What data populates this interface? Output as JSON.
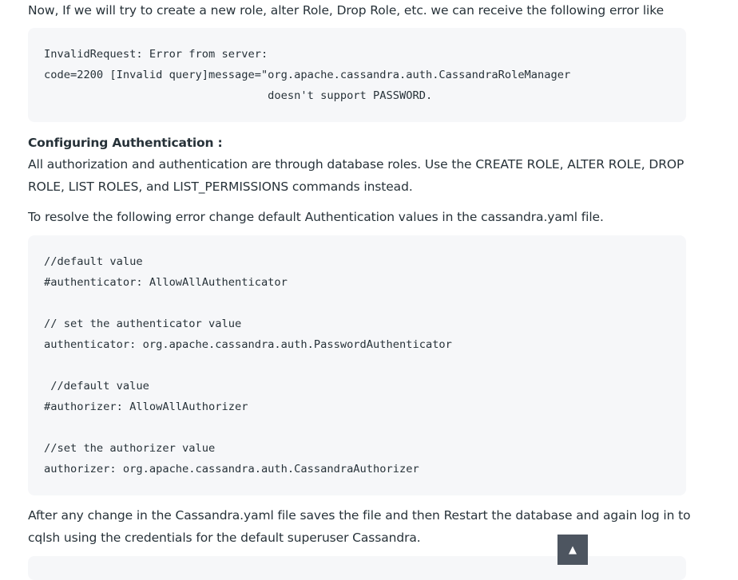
{
  "intro_text": "Now, If we will try to create a new role, alter Role, Drop Role, etc. we can receive the following error like",
  "error_code": "InvalidRequest: Error from server:\ncode=2200 [Invalid query]message=\"org.apache.cassandra.auth.CassandraRoleManager\n                                  doesn't support PASSWORD.",
  "heading": "Configuring Authentication :",
  "auth_text": "All authorization and authentication are through database roles. Use the CREATE ROLE, ALTER ROLE, DROP ROLE, LIST ROLES, and LIST_PERMISSIONS commands instead.",
  "resolve_text": "To resolve the following error change default Authentication values in the cassandra.yaml file.",
  "config_code": "//default value\n#authenticator: AllowAllAuthenticator\n\n// set the authenticator value\nauthenticator: org.apache.cassandra.auth.PasswordAuthenticator\n\n //default value\n#authorizer: AllowAllAuthorizer\n\n//set the authorizer value\nauthorizer: org.apache.cassandra.auth.CassandraAuthorizer",
  "restart_text": "After any change in the Cassandra.yaml file saves the file and then Restart the database and again log in to cqlsh using the credentials for the default superuser Cassandra.",
  "scroll_top_icon": "up-triangle-icon",
  "scroll_top_glyph": "▲"
}
